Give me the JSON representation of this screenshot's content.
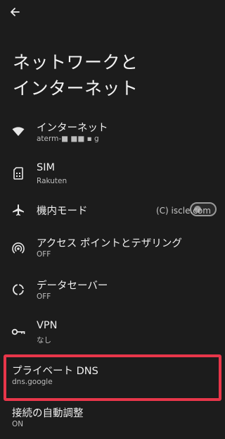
{
  "header": {
    "back_icon": "arrow-back-icon",
    "title_line1": "ネットワークと",
    "title_line2": "インターネット"
  },
  "items": [
    {
      "label": "インターネット",
      "sub": "aterm-■ ■■ ▪ g",
      "icon": "wifi-icon"
    },
    {
      "label": "SIM",
      "sub": "Rakuten",
      "icon": "sim-card-icon"
    },
    {
      "label": "機内モード",
      "sub": "",
      "icon": "airplane-icon"
    },
    {
      "label": "アクセス ポイントとテザリング",
      "sub": "OFF",
      "icon": "hotspot-icon"
    },
    {
      "label": "データセーバー",
      "sub": "OFF",
      "icon": "data-saver-icon"
    },
    {
      "label": "VPN",
      "sub": "なし",
      "icon": "vpn-key-icon"
    },
    {
      "label": "プライベート DNS",
      "sub": "dns.google",
      "icon": ""
    },
    {
      "label": "接続の自動調整",
      "sub": "ON",
      "icon": ""
    }
  ],
  "airplane_toggle": {
    "state": "off"
  },
  "watermark": "(C) iscle.com",
  "colors": {
    "background": "#1c1c1c",
    "highlight": "#e8364a",
    "text": "#efefef",
    "subtext": "#bdbdbd"
  }
}
